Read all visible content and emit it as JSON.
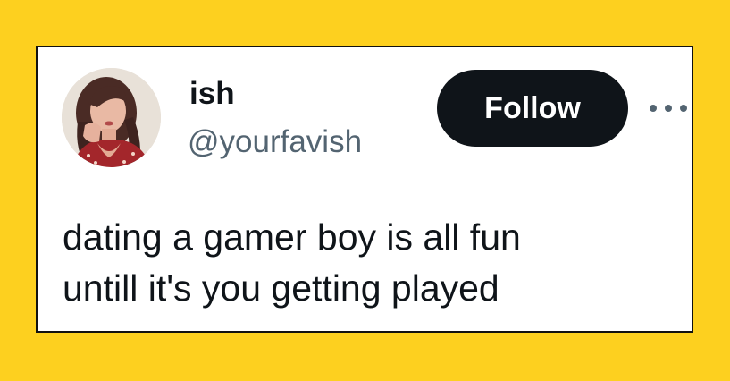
{
  "colors": {
    "background": "#FDD01F",
    "card": "#FFFFFF",
    "follow_button": "#0F1419",
    "handle": "#536471"
  },
  "tweet": {
    "author": {
      "display_name": "ish",
      "handle": "@yourfavish",
      "avatar_icon": "profile-photo"
    },
    "follow_label": "Follow",
    "more_icon": "ellipsis-icon",
    "text_lines": [
      "dating a gamer boy is all fun",
      "untill it's you getting played"
    ]
  }
}
